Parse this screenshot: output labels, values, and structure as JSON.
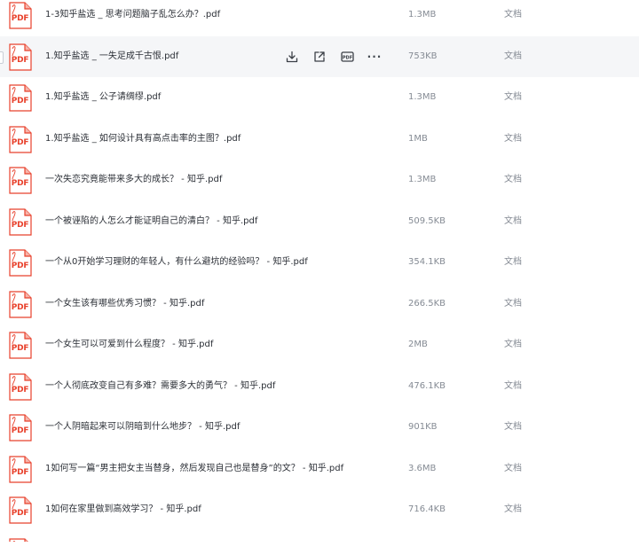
{
  "icon_label": "PDF",
  "colors": {
    "pdf_red": "#e8412c",
    "pdf_fold": "#f6b4aa",
    "row_hover_bg": "#f5f6f8",
    "name_text": "#2b2f36",
    "meta_text": "#858b94"
  },
  "row_actions_icons": [
    "download-icon",
    "share-icon",
    "pdf-convert-icon",
    "more-icon"
  ],
  "files": [
    {
      "name": "1-3知乎盐选 _ 思考问题脑子乱怎么办？.pdf",
      "size": "1.3MB",
      "type": "文档"
    },
    {
      "name": "1.知乎盐选 _ 一失足成千古恨.pdf",
      "size": "753KB",
      "type": "文档"
    },
    {
      "name": "1.知乎盐选 _ 公子请绸缪.pdf",
      "size": "1.3MB",
      "type": "文档"
    },
    {
      "name": "1.知乎盐选 _ 如何设计具有高点击率的主图？.pdf",
      "size": "1MB",
      "type": "文档"
    },
    {
      "name": "一次失恋究竟能带来多大的成长？ - 知乎.pdf",
      "size": "1.3MB",
      "type": "文档"
    },
    {
      "name": "一个被诬陷的人怎么才能证明自己的清白？ - 知乎.pdf",
      "size": "509.5KB",
      "type": "文档"
    },
    {
      "name": "一个从0开始学习理财的年轻人，有什么避坑的经验吗？ - 知乎.pdf",
      "size": "354.1KB",
      "type": "文档"
    },
    {
      "name": "一个女生该有哪些优秀习惯？ - 知乎.pdf",
      "size": "266.5KB",
      "type": "文档"
    },
    {
      "name": "一个女生可以可爱到什么程度？ - 知乎.pdf",
      "size": "2MB",
      "type": "文档"
    },
    {
      "name": "一个人彻底改变自己有多难？需要多大的勇气？ - 知乎.pdf",
      "size": "476.1KB",
      "type": "文档"
    },
    {
      "name": "一个人阴暗起来可以阴暗到什么地步？ - 知乎.pdf",
      "size": "901KB",
      "type": "文档"
    },
    {
      "name": "1如何写一篇“男主把女主当替身，然后发现自己也是替身”的文？ - 知乎.pdf",
      "size": "3.6MB",
      "type": "文档"
    },
    {
      "name": "1如何在家里做到高效学习？ - 知乎.pdf",
      "size": "716.4KB",
      "type": "文档"
    },
    {
      "name": "",
      "size": "",
      "type": ""
    }
  ]
}
